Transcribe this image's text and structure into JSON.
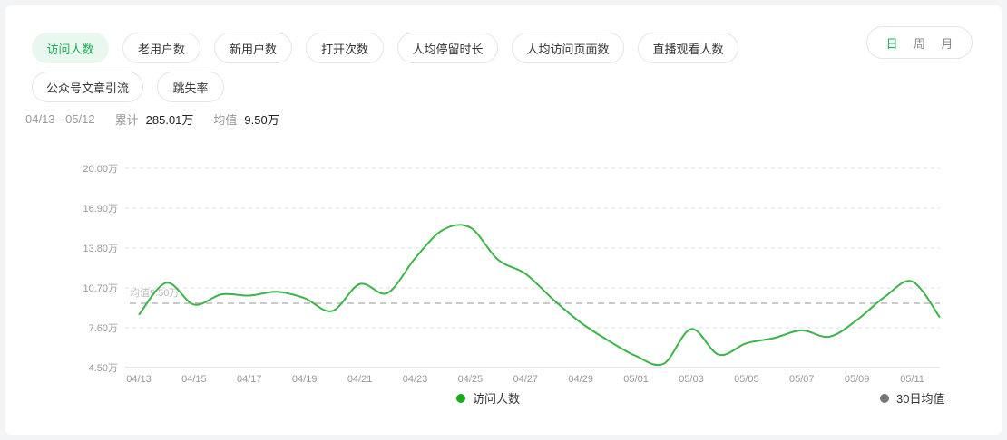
{
  "tabs": [
    {
      "label": "访问人数",
      "active": true
    },
    {
      "label": "老用户数",
      "active": false
    },
    {
      "label": "新用户数",
      "active": false
    },
    {
      "label": "打开次数",
      "active": false
    },
    {
      "label": "人均停留时长",
      "active": false
    },
    {
      "label": "人均访问页面数",
      "active": false
    },
    {
      "label": "直播观看人数",
      "active": false
    },
    {
      "label": "公众号文章引流",
      "active": false
    },
    {
      "label": "跳失率",
      "active": false
    }
  ],
  "period": {
    "options": [
      "日",
      "周",
      "月"
    ],
    "selected": "日"
  },
  "summary": {
    "range": "04/13 - 05/12",
    "total_label": "累计",
    "total_value": "285.01万",
    "avg_label": "均值",
    "avg_value": "9.50万"
  },
  "colors": {
    "accent": "#1aad5a",
    "line": "#3bb44a",
    "avg": "#aaaaaa"
  },
  "chart_data": {
    "type": "line",
    "ylim": [
      4.5,
      20.0
    ],
    "y_ticks": [
      "4.50万",
      "7.60万",
      "10.70万",
      "13.80万",
      "16.90万",
      "20.00万"
    ],
    "y_tick_values": [
      4.5,
      7.6,
      10.7,
      13.8,
      16.9,
      20.0
    ],
    "x_tick_labels": [
      "04/13",
      "04/15",
      "04/17",
      "04/19",
      "04/21",
      "04/23",
      "04/25",
      "04/27",
      "04/29",
      "05/01",
      "05/03",
      "05/05",
      "05/07",
      "05/09",
      "05/11"
    ],
    "x": [
      "04/13",
      "04/14",
      "04/15",
      "04/16",
      "04/17",
      "04/18",
      "04/19",
      "04/20",
      "04/21",
      "04/22",
      "04/23",
      "04/24",
      "04/25",
      "04/26",
      "04/27",
      "04/28",
      "04/29",
      "04/30",
      "05/01",
      "05/02",
      "05/03",
      "05/04",
      "05/05",
      "05/06",
      "05/07",
      "05/08",
      "05/09",
      "05/10",
      "05/11",
      "05/12"
    ],
    "series": [
      {
        "name": "访问人数",
        "values": [
          8.6,
          11.1,
          9.4,
          10.2,
          10.1,
          10.4,
          9.9,
          8.9,
          11.0,
          10.3,
          13.0,
          15.2,
          15.4,
          12.9,
          11.8,
          9.8,
          8.0,
          6.6,
          5.4,
          4.8,
          7.5,
          5.5,
          6.4,
          6.8,
          7.4,
          6.9,
          8.2,
          10.0,
          11.2,
          8.4
        ]
      }
    ],
    "average": {
      "label": "均值9.50万",
      "value": 9.5,
      "legend": "30日均值"
    }
  }
}
